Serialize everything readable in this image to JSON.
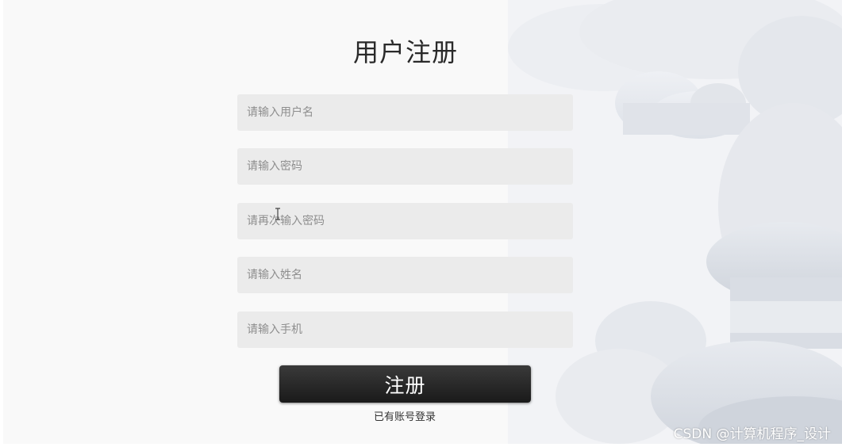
{
  "page": {
    "title": "用户注册"
  },
  "form": {
    "username_placeholder": "请输入用户名",
    "password_placeholder": "请输入密码",
    "confirm_password_placeholder": "请再次输入密码",
    "name_placeholder": "请输入姓名",
    "phone_placeholder": "请输入手机",
    "submit_label": "注册",
    "login_link_label": "已有账号登录"
  },
  "watermark": {
    "text": "CSDN @计算机程序_设计"
  },
  "colors": {
    "page_background": "#f9f9f9",
    "field_background": "#ebebeb",
    "button_background": "#232323",
    "button_text": "#ffffff",
    "title_text": "#2a2a2a"
  },
  "icons": {
    "text_cursor": "text-cursor-icon"
  }
}
